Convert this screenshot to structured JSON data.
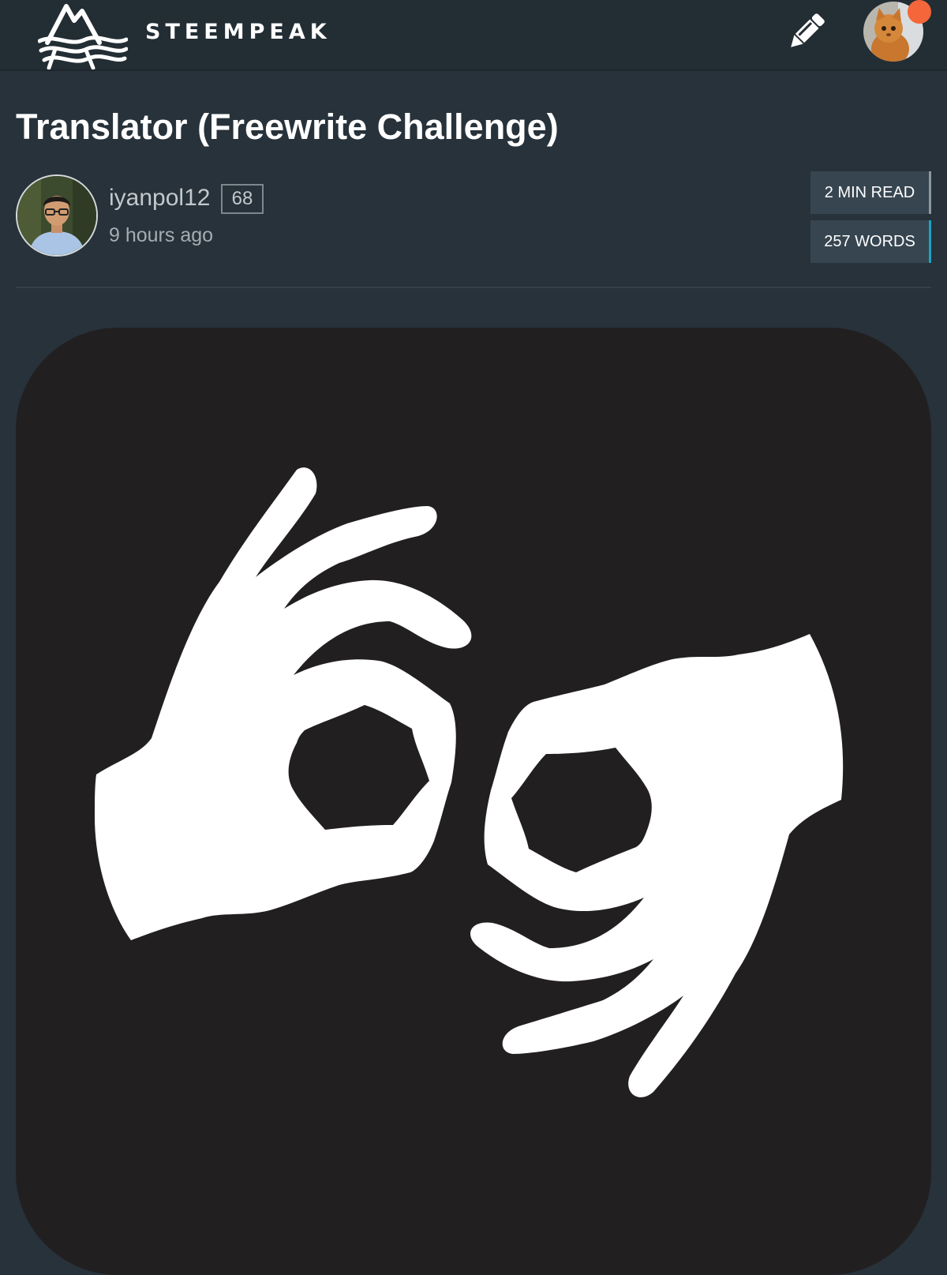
{
  "header": {
    "brand": "STEEMPEAK",
    "logo_icon": "steempeak-mountain-logo",
    "write_icon": "pencil-icon",
    "notification_color": "#f5663a"
  },
  "post": {
    "title": "Translator (Freewrite Challenge)",
    "author": {
      "name": "iyanpol12",
      "reputation": "68",
      "posted": "9 hours ago"
    },
    "stats": {
      "read_time": "2 MIN READ",
      "word_count": "257 WORDS"
    },
    "image_icon": "sign-language-hands-icon"
  },
  "colors": {
    "page_background": "#27323a",
    "topbar_background": "#232d34",
    "stat_background": "#364550",
    "words_accent": "#18a5c4",
    "image_background": "#221f21"
  }
}
